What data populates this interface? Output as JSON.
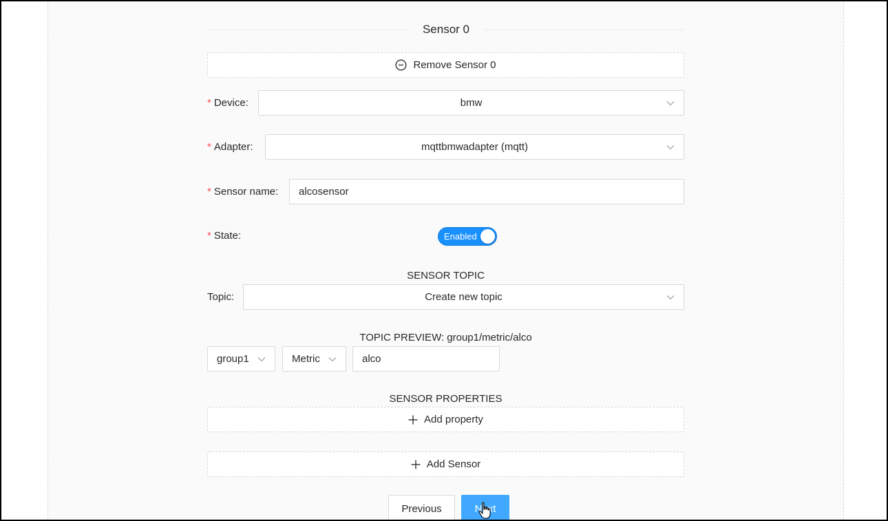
{
  "sensor_header": {
    "title": "Sensor 0"
  },
  "remove_sensor": {
    "label": "Remove Sensor 0",
    "icon": "minus-circle-icon"
  },
  "fields": {
    "device": {
      "label": "Device",
      "value": "bmw",
      "colon": ":"
    },
    "adapter": {
      "label": "Adapter",
      "value": "mqttbmwadapter (mqtt)",
      "colon": ":"
    },
    "sensor_name": {
      "label": "Sensor name",
      "value": "alcosensor",
      "colon": ":"
    },
    "state": {
      "label": "State",
      "colon": ":",
      "switch_text": "Enabled",
      "enabled": true
    }
  },
  "required_mark": "*",
  "topic_section": {
    "title": "SENSOR TOPIC",
    "topic_label": "Topic",
    "topic_colon": ":",
    "topic_value": "Create new topic",
    "preview": "TOPIC PREVIEW: group1/metric/alco",
    "group_value": "group1",
    "type_value": "Metric",
    "name_value": "alco"
  },
  "properties_section": {
    "title": "SENSOR PROPERTIES",
    "add_property_label": "Add property"
  },
  "add_sensor": {
    "label": "Add Sensor"
  },
  "footer": {
    "previous_label": "Previous",
    "next_label": "Next"
  },
  "colors": {
    "primary": "#1890ff",
    "primary_hover": "#40a9ff",
    "required": "#ff4d4f",
    "border": "#d9d9d9",
    "panel_bg": "#fafafa"
  }
}
